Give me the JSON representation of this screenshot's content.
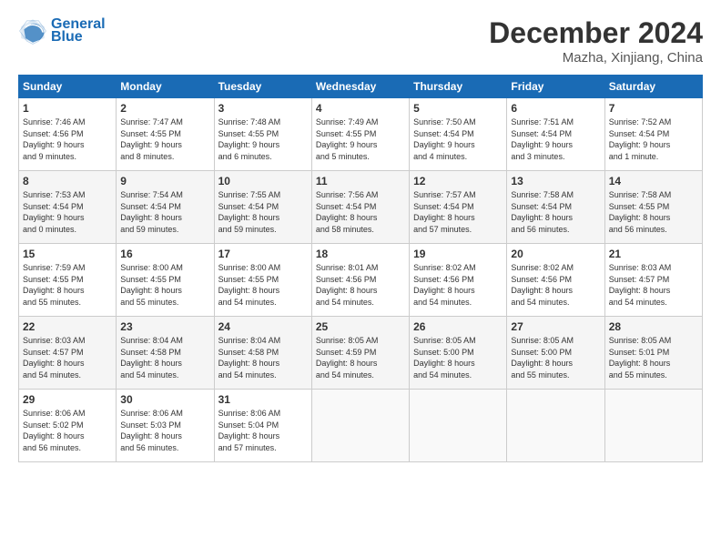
{
  "logo": {
    "line1": "General",
    "line2": "Blue"
  },
  "title": "December 2024",
  "subtitle": "Mazha, Xinjiang, China",
  "header": {
    "days": [
      "Sunday",
      "Monday",
      "Tuesday",
      "Wednesday",
      "Thursday",
      "Friday",
      "Saturday"
    ]
  },
  "weeks": [
    [
      {
        "day": "1",
        "info": "Sunrise: 7:46 AM\nSunset: 4:56 PM\nDaylight: 9 hours\nand 9 minutes."
      },
      {
        "day": "2",
        "info": "Sunrise: 7:47 AM\nSunset: 4:55 PM\nDaylight: 9 hours\nand 8 minutes."
      },
      {
        "day": "3",
        "info": "Sunrise: 7:48 AM\nSunset: 4:55 PM\nDaylight: 9 hours\nand 6 minutes."
      },
      {
        "day": "4",
        "info": "Sunrise: 7:49 AM\nSunset: 4:55 PM\nDaylight: 9 hours\nand 5 minutes."
      },
      {
        "day": "5",
        "info": "Sunrise: 7:50 AM\nSunset: 4:54 PM\nDaylight: 9 hours\nand 4 minutes."
      },
      {
        "day": "6",
        "info": "Sunrise: 7:51 AM\nSunset: 4:54 PM\nDaylight: 9 hours\nand 3 minutes."
      },
      {
        "day": "7",
        "info": "Sunrise: 7:52 AM\nSunset: 4:54 PM\nDaylight: 9 hours\nand 1 minute."
      }
    ],
    [
      {
        "day": "8",
        "info": "Sunrise: 7:53 AM\nSunset: 4:54 PM\nDaylight: 9 hours\nand 0 minutes."
      },
      {
        "day": "9",
        "info": "Sunrise: 7:54 AM\nSunset: 4:54 PM\nDaylight: 8 hours\nand 59 minutes."
      },
      {
        "day": "10",
        "info": "Sunrise: 7:55 AM\nSunset: 4:54 PM\nDaylight: 8 hours\nand 59 minutes."
      },
      {
        "day": "11",
        "info": "Sunrise: 7:56 AM\nSunset: 4:54 PM\nDaylight: 8 hours\nand 58 minutes."
      },
      {
        "day": "12",
        "info": "Sunrise: 7:57 AM\nSunset: 4:54 PM\nDaylight: 8 hours\nand 57 minutes."
      },
      {
        "day": "13",
        "info": "Sunrise: 7:58 AM\nSunset: 4:54 PM\nDaylight: 8 hours\nand 56 minutes."
      },
      {
        "day": "14",
        "info": "Sunrise: 7:58 AM\nSunset: 4:55 PM\nDaylight: 8 hours\nand 56 minutes."
      }
    ],
    [
      {
        "day": "15",
        "info": "Sunrise: 7:59 AM\nSunset: 4:55 PM\nDaylight: 8 hours\nand 55 minutes."
      },
      {
        "day": "16",
        "info": "Sunrise: 8:00 AM\nSunset: 4:55 PM\nDaylight: 8 hours\nand 55 minutes."
      },
      {
        "day": "17",
        "info": "Sunrise: 8:00 AM\nSunset: 4:55 PM\nDaylight: 8 hours\nand 54 minutes."
      },
      {
        "day": "18",
        "info": "Sunrise: 8:01 AM\nSunset: 4:56 PM\nDaylight: 8 hours\nand 54 minutes."
      },
      {
        "day": "19",
        "info": "Sunrise: 8:02 AM\nSunset: 4:56 PM\nDaylight: 8 hours\nand 54 minutes."
      },
      {
        "day": "20",
        "info": "Sunrise: 8:02 AM\nSunset: 4:56 PM\nDaylight: 8 hours\nand 54 minutes."
      },
      {
        "day": "21",
        "info": "Sunrise: 8:03 AM\nSunset: 4:57 PM\nDaylight: 8 hours\nand 54 minutes."
      }
    ],
    [
      {
        "day": "22",
        "info": "Sunrise: 8:03 AM\nSunset: 4:57 PM\nDaylight: 8 hours\nand 54 minutes."
      },
      {
        "day": "23",
        "info": "Sunrise: 8:04 AM\nSunset: 4:58 PM\nDaylight: 8 hours\nand 54 minutes."
      },
      {
        "day": "24",
        "info": "Sunrise: 8:04 AM\nSunset: 4:58 PM\nDaylight: 8 hours\nand 54 minutes."
      },
      {
        "day": "25",
        "info": "Sunrise: 8:05 AM\nSunset: 4:59 PM\nDaylight: 8 hours\nand 54 minutes."
      },
      {
        "day": "26",
        "info": "Sunrise: 8:05 AM\nSunset: 5:00 PM\nDaylight: 8 hours\nand 54 minutes."
      },
      {
        "day": "27",
        "info": "Sunrise: 8:05 AM\nSunset: 5:00 PM\nDaylight: 8 hours\nand 55 minutes."
      },
      {
        "day": "28",
        "info": "Sunrise: 8:05 AM\nSunset: 5:01 PM\nDaylight: 8 hours\nand 55 minutes."
      }
    ],
    [
      {
        "day": "29",
        "info": "Sunrise: 8:06 AM\nSunset: 5:02 PM\nDaylight: 8 hours\nand 56 minutes."
      },
      {
        "day": "30",
        "info": "Sunrise: 8:06 AM\nSunset: 5:03 PM\nDaylight: 8 hours\nand 56 minutes."
      },
      {
        "day": "31",
        "info": "Sunrise: 8:06 AM\nSunset: 5:04 PM\nDaylight: 8 hours\nand 57 minutes."
      },
      {
        "day": "",
        "info": ""
      },
      {
        "day": "",
        "info": ""
      },
      {
        "day": "",
        "info": ""
      },
      {
        "day": "",
        "info": ""
      }
    ]
  ]
}
